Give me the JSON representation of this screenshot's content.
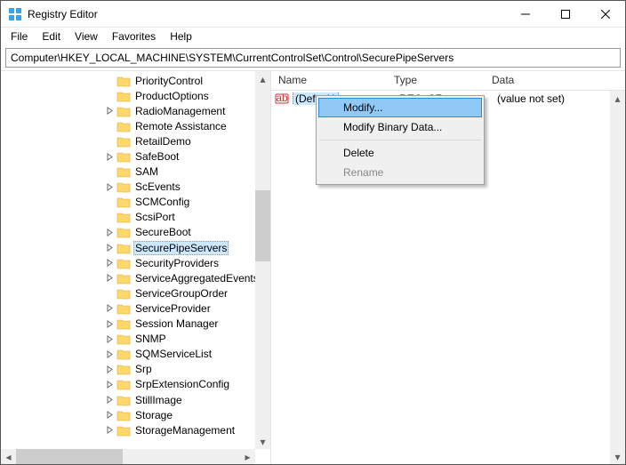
{
  "window": {
    "title": "Registry Editor"
  },
  "menu": {
    "file": "File",
    "edit": "Edit",
    "view": "View",
    "favorites": "Favorites",
    "help": "Help"
  },
  "address": "Computer\\HKEY_LOCAL_MACHINE\\SYSTEM\\CurrentControlSet\\Control\\SecurePipeServers",
  "columns": {
    "name": "Name",
    "type": "Type",
    "data": "Data"
  },
  "tree": {
    "items": [
      {
        "label": "PriorityControl",
        "exp": ""
      },
      {
        "label": "ProductOptions",
        "exp": ""
      },
      {
        "label": "RadioManagement",
        "exp": ">"
      },
      {
        "label": "Remote Assistance",
        "exp": ""
      },
      {
        "label": "RetailDemo",
        "exp": ""
      },
      {
        "label": "SafeBoot",
        "exp": ">"
      },
      {
        "label": "SAM",
        "exp": ""
      },
      {
        "label": "ScEvents",
        "exp": ">"
      },
      {
        "label": "SCMConfig",
        "exp": ""
      },
      {
        "label": "ScsiPort",
        "exp": ""
      },
      {
        "label": "SecureBoot",
        "exp": ">"
      },
      {
        "label": "SecurePipeServers",
        "exp": ">",
        "selected": true
      },
      {
        "label": "SecurityProviders",
        "exp": ">"
      },
      {
        "label": "ServiceAggregatedEvents",
        "exp": ">"
      },
      {
        "label": "ServiceGroupOrder",
        "exp": ""
      },
      {
        "label": "ServiceProvider",
        "exp": ">"
      },
      {
        "label": "Session Manager",
        "exp": ">"
      },
      {
        "label": "SNMP",
        "exp": ">"
      },
      {
        "label": "SQMServiceList",
        "exp": ">"
      },
      {
        "label": "Srp",
        "exp": ">"
      },
      {
        "label": "SrpExtensionConfig",
        "exp": ">"
      },
      {
        "label": "StillImage",
        "exp": ">"
      },
      {
        "label": "Storage",
        "exp": ">"
      },
      {
        "label": "StorageManagement",
        "exp": ">"
      }
    ]
  },
  "value_row": {
    "name": "(Default)",
    "type": "REG_SZ",
    "data": "(value not set)"
  },
  "context": {
    "modify": "Modify...",
    "modify_binary": "Modify Binary Data...",
    "delete": "Delete",
    "rename": "Rename"
  }
}
